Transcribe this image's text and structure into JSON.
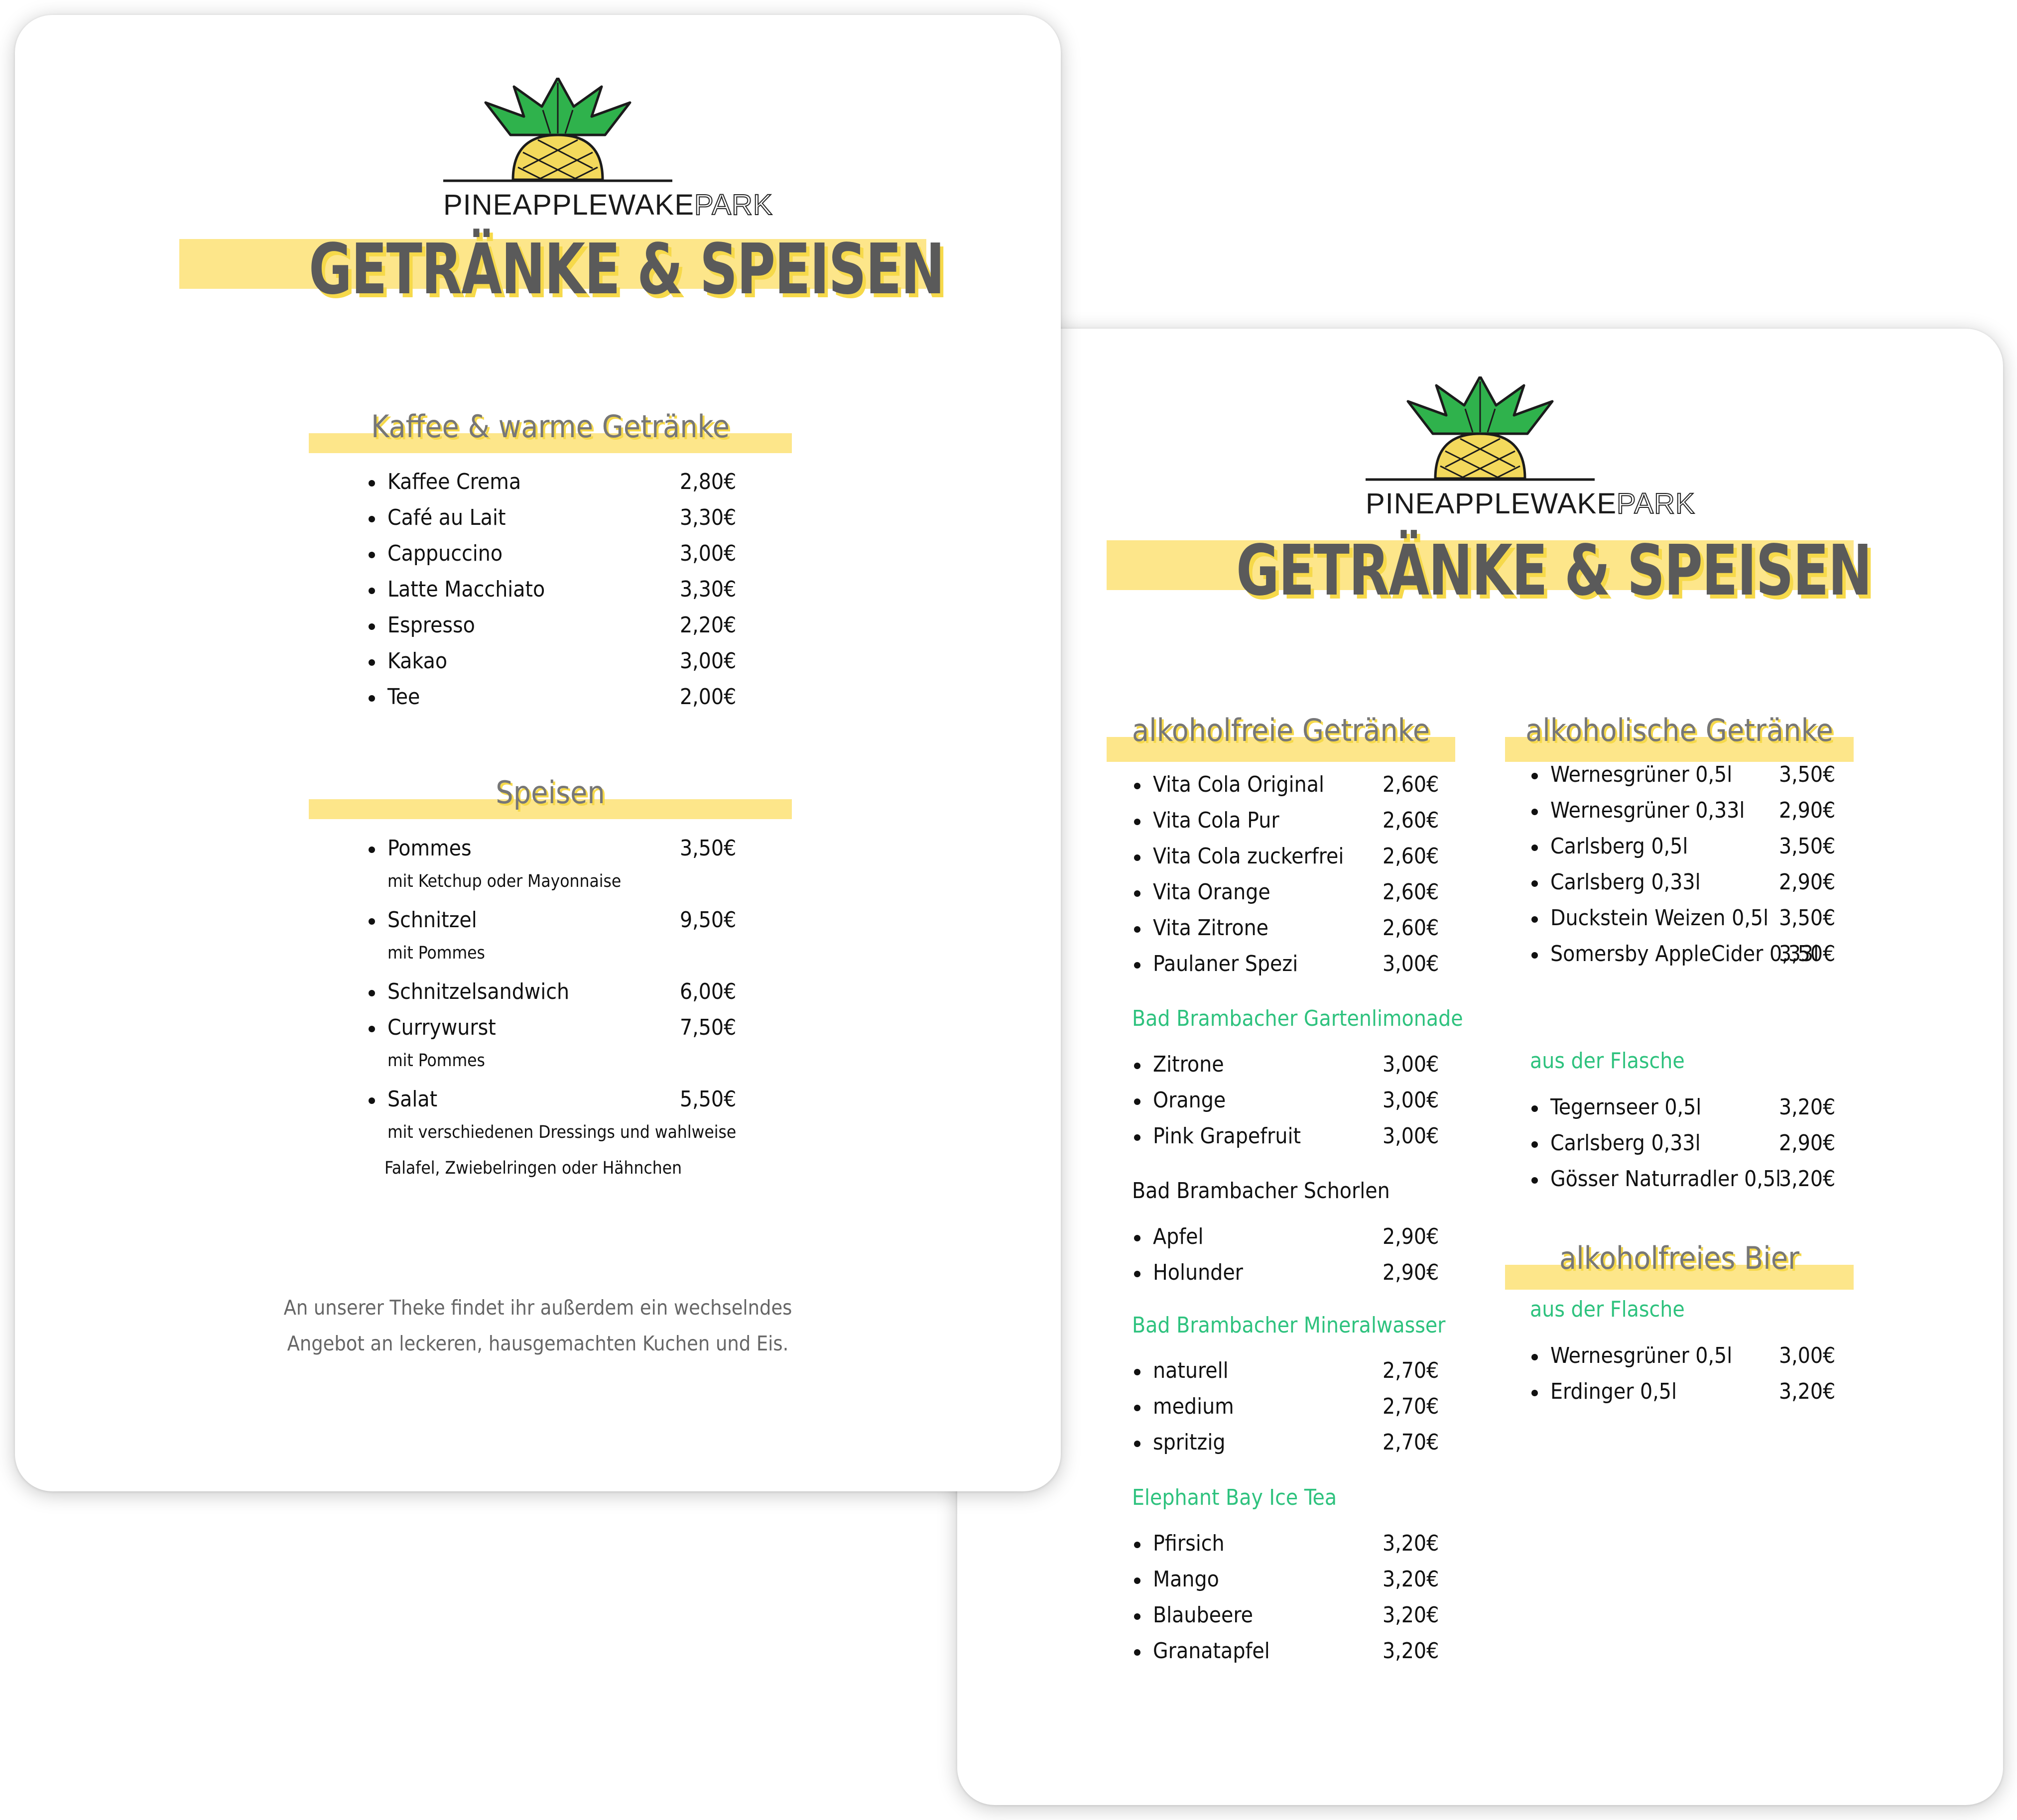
{
  "brand": {
    "name_main": "PINEAPPLEWAKE",
    "name_accent": "PARK"
  },
  "colors": {
    "accent_yellow": "#fde68a",
    "shadow_yellow": "#f6d94a",
    "title_gray": "#5a5a5a",
    "green": "#2ec27e",
    "leaf_green": "#2fb24c",
    "pineapple_yellow": "#f3d95c"
  },
  "icons": {
    "logo": "pineapple-icon",
    "bullet": "bullet-icon"
  },
  "left": {
    "title": "GETRÄNKE & SPEISEN",
    "sections": {
      "kaffee": {
        "title": "Kaffee & warme Getränke",
        "items": [
          {
            "name": "Kaffee Crema",
            "price": "2,80€"
          },
          {
            "name": "Café au Lait",
            "price": "3,30€"
          },
          {
            "name": "Cappuccino",
            "price": "3,00€"
          },
          {
            "name": "Latte Macchiato",
            "price": "3,30€"
          },
          {
            "name": "Espresso",
            "price": "2,20€"
          },
          {
            "name": "Kakao",
            "price": "3,00€"
          },
          {
            "name": "Tee",
            "price": "2,00€"
          }
        ]
      },
      "speisen": {
        "title": "Speisen",
        "items": [
          {
            "name": "Pommes",
            "price": "3,50€",
            "note": "mit Ketchup oder Mayonnaise"
          },
          {
            "name": "Schnitzel",
            "price": "9,50€",
            "note": "mit Pommes"
          },
          {
            "name": "Schnitzelsandwich",
            "price": "6,00€"
          },
          {
            "name": "Currywurst",
            "price": "7,50€",
            "note": "mit Pommes"
          },
          {
            "name": "Salat",
            "price": "5,50€",
            "note": "mit verschiedenen Dressings und wahlweise",
            "note2": "Falafel, Zwiebelringen oder Hähnchen"
          }
        ]
      }
    },
    "footer": {
      "line1": "An unserer Theke findet ihr außerdem ein wechselndes",
      "line2": "Angebot an leckeren, hausgemachten Kuchen und Eis."
    }
  },
  "right": {
    "title": "GETRÄNKE & SPEISEN",
    "alkoholfrei": {
      "title": "alkoholfreie Getränke",
      "items": [
        {
          "name": "Vita Cola Original",
          "price": "2,60€"
        },
        {
          "name": "Vita Cola Pur",
          "price": "2,60€"
        },
        {
          "name": "Vita Cola zuckerfrei",
          "price": "2,60€"
        },
        {
          "name": "Vita Orange",
          "price": "2,60€"
        },
        {
          "name": "Vita Zitrone",
          "price": "2,60€"
        },
        {
          "name": "Paulaner Spezi",
          "price": "3,00€"
        }
      ],
      "garten": {
        "title": "Bad Brambacher Gartenlimonade",
        "items": [
          {
            "name": "Zitrone",
            "price": "3,00€"
          },
          {
            "name": "Orange",
            "price": "3,00€"
          },
          {
            "name": "Pink Grapefruit",
            "price": "3,00€"
          }
        ]
      },
      "schorlen": {
        "title": "Bad Brambacher Schorlen",
        "items": [
          {
            "name": "Apfel",
            "price": "2,90€"
          },
          {
            "name": "Holunder",
            "price": "2,90€"
          }
        ]
      },
      "mineral": {
        "title": "Bad Brambacher Mineralwasser",
        "items": [
          {
            "name": "naturell",
            "price": "2,70€"
          },
          {
            "name": "medium",
            "price": "2,70€"
          },
          {
            "name": "spritzig",
            "price": "2,70€"
          }
        ]
      },
      "icetea": {
        "title": "Elephant Bay Ice Tea",
        "items": [
          {
            "name": "Pfirsich",
            "price": "3,20€"
          },
          {
            "name": "Mango",
            "price": "3,20€"
          },
          {
            "name": "Blaubeere",
            "price": "3,20€"
          },
          {
            "name": "Granatapfel",
            "price": "3,20€"
          }
        ]
      }
    },
    "alkoholisch": {
      "title": "alkoholische Getränke",
      "items": [
        {
          "name": "Wernesgrüner 0,5l",
          "price": "3,50€"
        },
        {
          "name": "Wernesgrüner 0,33l",
          "price": "2,90€"
        },
        {
          "name": "Carlsberg 0,5l",
          "price": "3,50€"
        },
        {
          "name": "Carlsberg 0,33l",
          "price": "2,90€"
        },
        {
          "name": "Duckstein Weizen 0,5l",
          "price": "3,50€"
        },
        {
          "name": "Somersby AppleCider 0,33l",
          "price": "3,50€"
        }
      ],
      "flasche": {
        "title": "aus der Flasche",
        "items": [
          {
            "name": "Tegernseer 0,5l",
            "price": "3,20€"
          },
          {
            "name": "Carlsberg 0,33l",
            "price": "2,90€"
          },
          {
            "name": "Gösser Naturradler 0,5l",
            "price": "3,20€"
          }
        ]
      }
    },
    "bier": {
      "title": "alkoholfreies Bier",
      "flasche": {
        "title": "aus der Flasche",
        "items": [
          {
            "name": "Wernesgrüner 0,5l",
            "price": "3,00€"
          },
          {
            "name": "Erdinger 0,5l",
            "price": "3,20€"
          }
        ]
      }
    }
  }
}
